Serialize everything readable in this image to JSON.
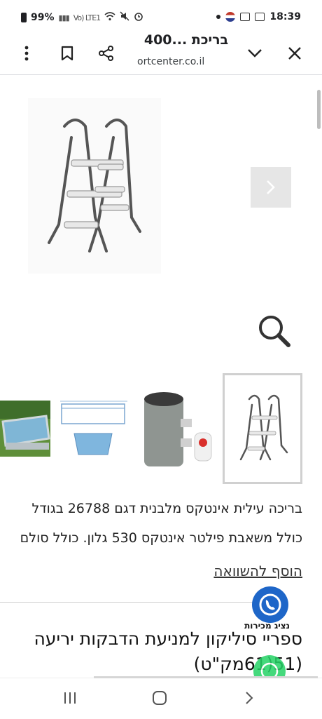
{
  "status_bar": {
    "battery": "99%",
    "network": "Vo) LTE1",
    "time": "18:39"
  },
  "browser": {
    "title": "בריכת ...400",
    "url": "ortcenter.co.il",
    "icons": [
      "more-vert-icon",
      "bookmark-icon",
      "share-icon",
      "chevron-down-icon",
      "close-icon"
    ]
  },
  "gallery": {
    "main_image": "pool-ladder",
    "thumbnails": [
      "pool-photo",
      "pool-diagram",
      "filter-pump",
      "pool-ladder"
    ],
    "selected_thumbnail": 3
  },
  "product": {
    "description_line1": "בריכה עילית אינטקס מלבנית דגם 26788 בגודל",
    "description_line2": "כולל משאבת פילטר אינטקס 530 גלון. כולל סולם",
    "compare_link": "הוסף להשוואה",
    "next_title_line1": "ספריי סיליקון למניעת הדבקות יריעה",
    "next_title_line2": "(51(61מק\"ט)"
  },
  "floating": {
    "whatsapp_label": "נציג מכירות"
  },
  "colors": {
    "whatsapp_blue": "#1e66c8",
    "whatsapp_green": "#25d366",
    "divider": "#cfcfcf"
  }
}
